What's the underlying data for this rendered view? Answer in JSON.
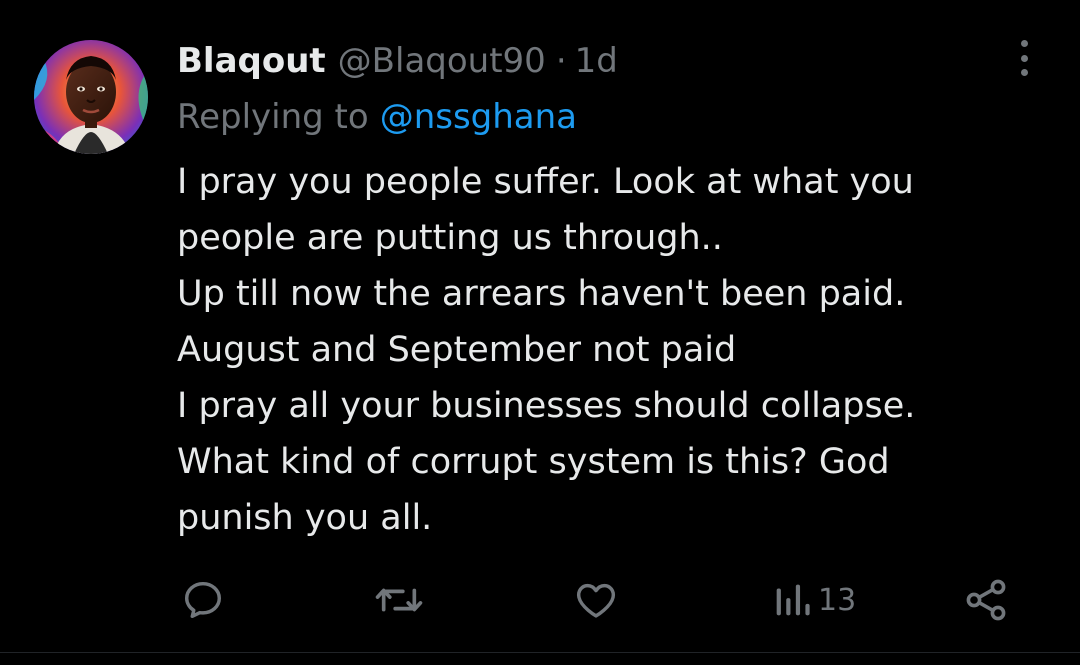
{
  "tweet": {
    "display_name": "Blaqout",
    "handle": "@Blaqout90",
    "separator": "·",
    "time": "1d",
    "reply_prefix": "Replying to",
    "reply_mention": "@nssghana",
    "body_lines": [
      "I pray you people suffer. Look at what you",
      "people are putting us through..",
      "Up till now the arrears haven't been paid.",
      "August and September not paid",
      "I pray all your businesses should collapse.",
      "What kind of corrupt system is this? God",
      "punish you all."
    ]
  },
  "actions": {
    "reply_icon": "reply-icon",
    "retweet_icon": "retweet-icon",
    "like_icon": "heart-icon",
    "views_icon": "views-icon",
    "views_count": "13",
    "share_icon": "share-icon",
    "more_icon": "more-vertical-icon"
  },
  "colors": {
    "background": "#000000",
    "text_primary": "#e7e9ea",
    "text_secondary": "#71767b",
    "accent": "#1d9bf0"
  }
}
